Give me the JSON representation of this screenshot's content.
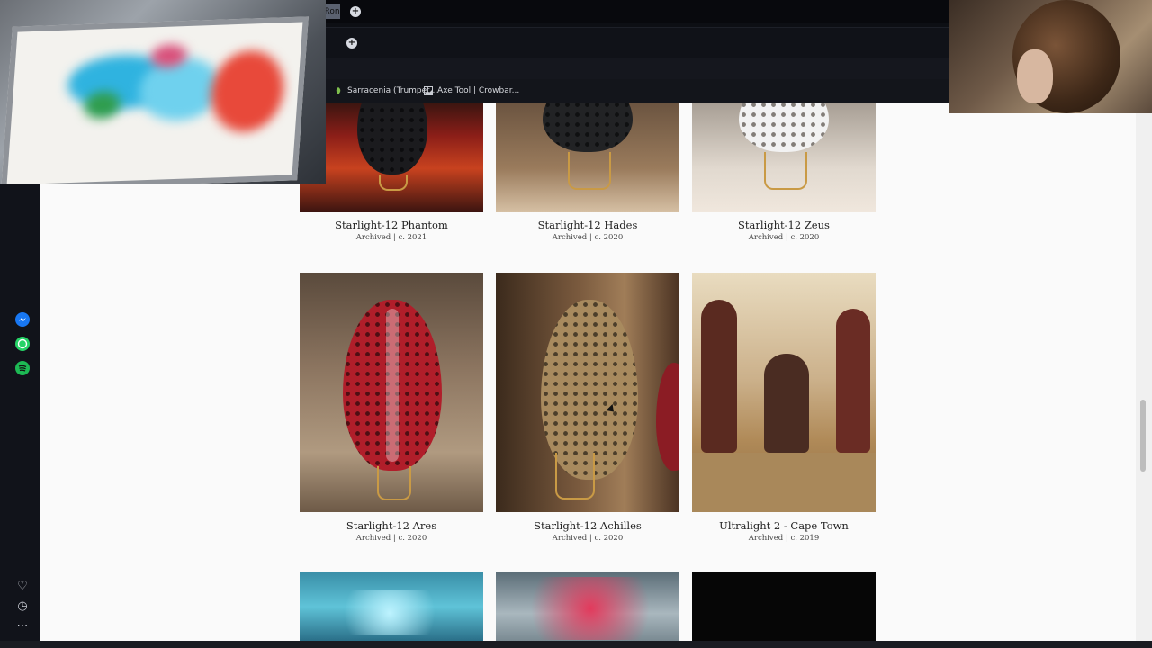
{
  "browser": {
    "tab_fragment": "Ron",
    "bookmarks": [
      {
        "label": "Sarracenia (Trumpet...",
        "icon": "plant-icon"
      },
      {
        "label": "Axe Tool | Crowbar...",
        "icon": "image-icon"
      }
    ]
  },
  "sidebar": {
    "apps": [
      {
        "name": "messenger-icon",
        "color": "#1877f2"
      },
      {
        "name": "whatsapp-icon",
        "color": "#25d366"
      },
      {
        "name": "spotify-icon",
        "color": "#1db954"
      }
    ],
    "bottom": [
      {
        "name": "heart-icon",
        "glyph": "♡"
      },
      {
        "name": "clock-icon",
        "glyph": "◷"
      },
      {
        "name": "more-icon",
        "glyph": "⋯"
      }
    ]
  },
  "gallery": {
    "row1": [
      {
        "title": "Starlight-12 Phantom",
        "meta": "Archived | c. 2021"
      },
      {
        "title": "Starlight-12 Hades",
        "meta": "Archived | c. 2020"
      },
      {
        "title": "Starlight-12 Zeus",
        "meta": "Archived | c. 2020"
      }
    ],
    "row2": [
      {
        "title": "Starlight-12 Ares",
        "meta": "Archived | c. 2020"
      },
      {
        "title": "Starlight-12 Achilles",
        "meta": "Archived | c. 2020"
      },
      {
        "title": "Ultralight 2 - Cape Town",
        "meta": "Archived | c. 2019"
      }
    ]
  }
}
